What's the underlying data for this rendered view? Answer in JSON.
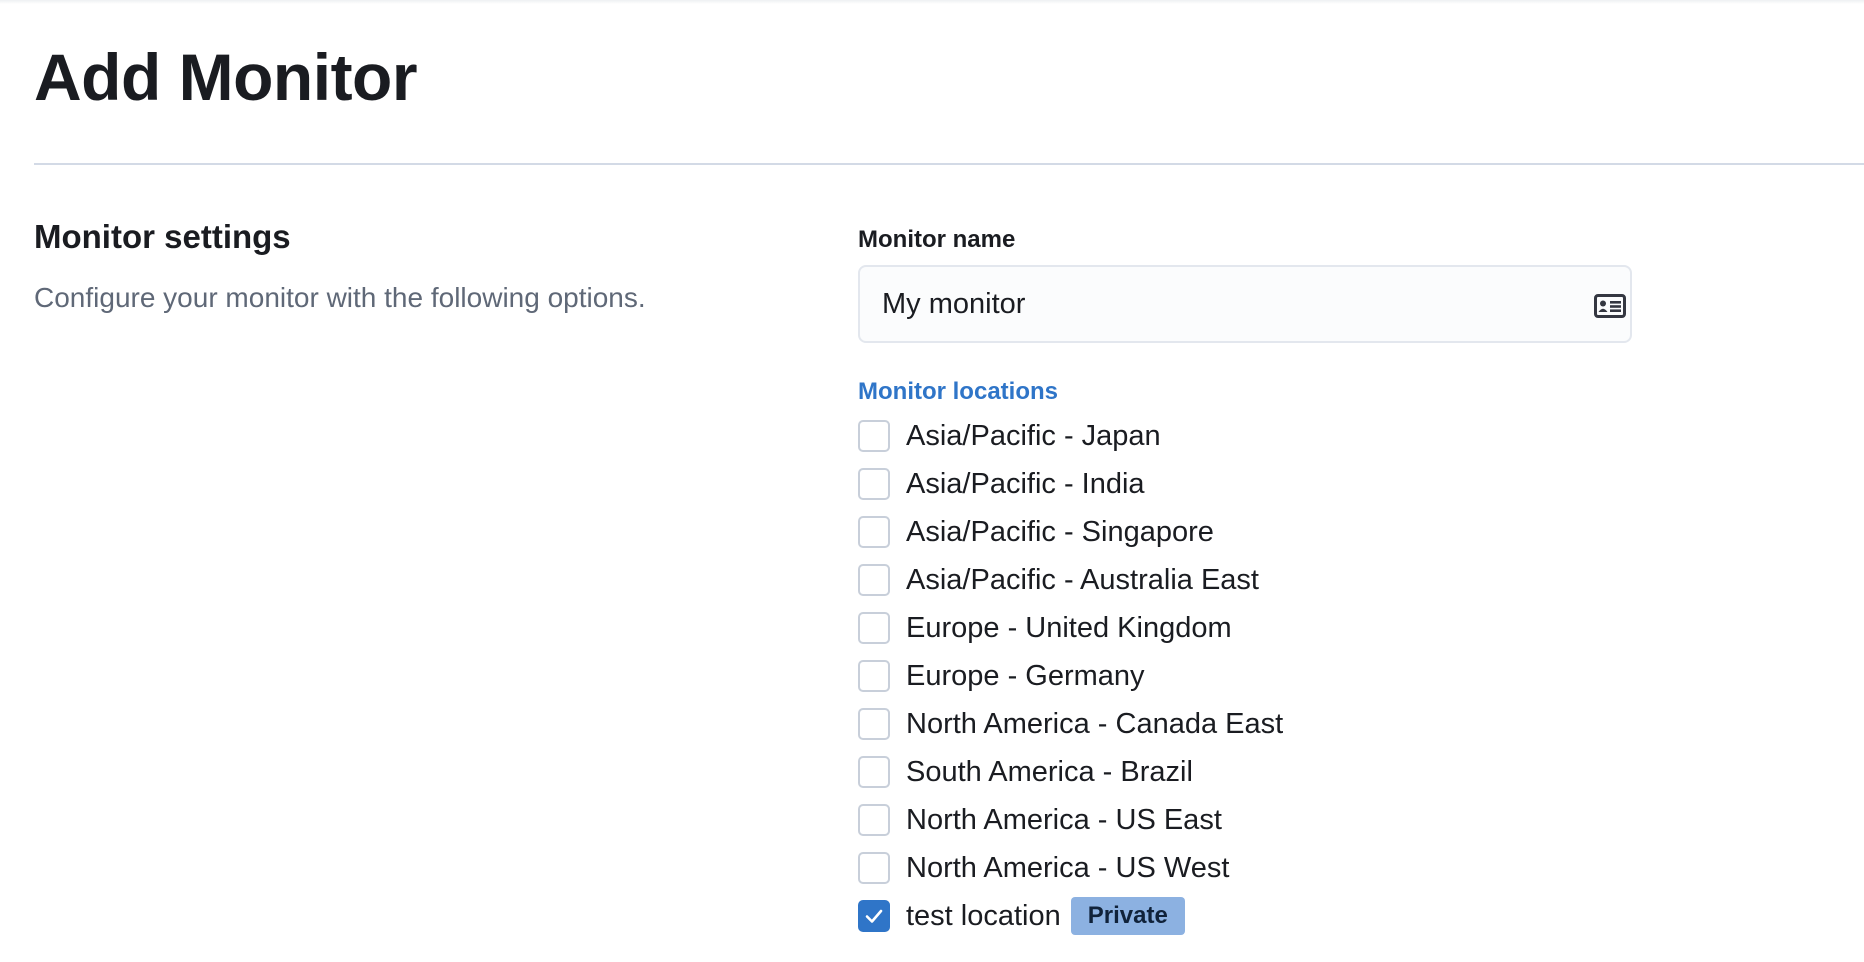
{
  "page": {
    "title": "Add Monitor"
  },
  "section": {
    "title": "Monitor settings",
    "description": "Configure your monitor with the following options."
  },
  "monitor_name": {
    "label": "Monitor name",
    "value": "My monitor",
    "icon": "id-card-icon"
  },
  "locations": {
    "label": "Monitor locations",
    "items": [
      {
        "label": "Asia/Pacific - Japan",
        "checked": false
      },
      {
        "label": "Asia/Pacific - India",
        "checked": false
      },
      {
        "label": "Asia/Pacific - Singapore",
        "checked": false
      },
      {
        "label": "Asia/Pacific - Australia East",
        "checked": false
      },
      {
        "label": "Europe - United Kingdom",
        "checked": false
      },
      {
        "label": "Europe - Germany",
        "checked": false
      },
      {
        "label": "North America - Canada East",
        "checked": false
      },
      {
        "label": "South America - Brazil",
        "checked": false
      },
      {
        "label": "North America - US East",
        "checked": false
      },
      {
        "label": "North America - US West",
        "checked": false
      },
      {
        "label": "test location",
        "checked": true,
        "badge": "Private"
      }
    ]
  },
  "colors": {
    "accent": "#2f75c8",
    "badge_bg": "#8cb1e1",
    "muted_text": "#5f6877"
  }
}
